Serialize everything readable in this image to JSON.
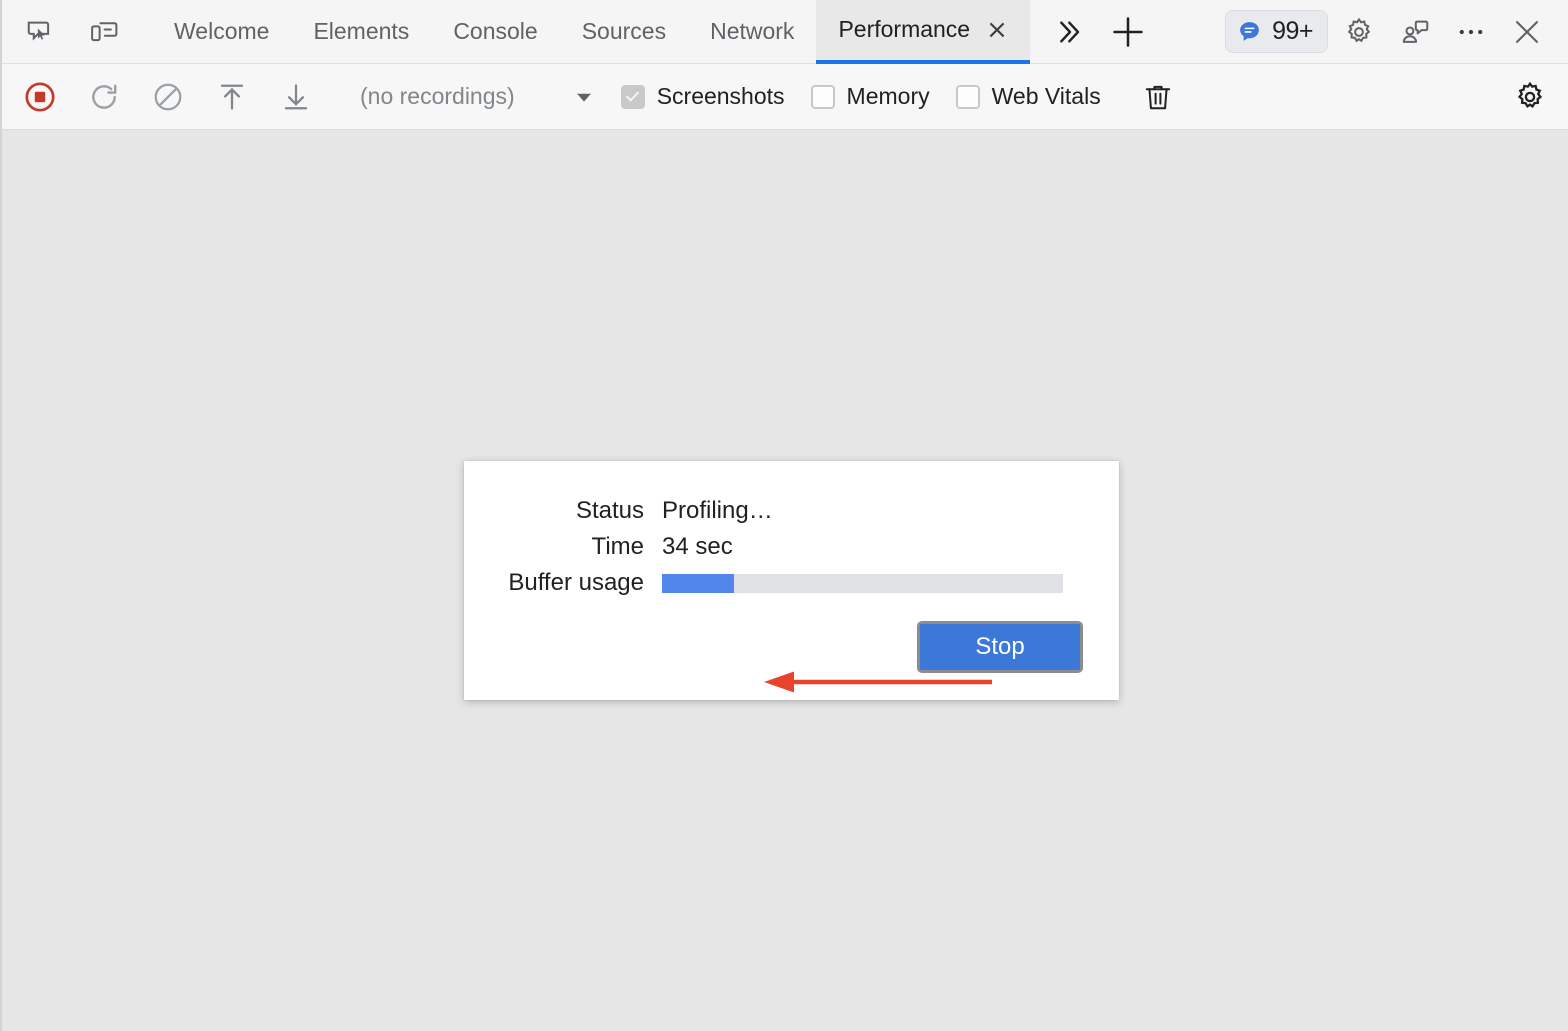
{
  "window": {
    "title": "Chrome DevTools – Performance panel"
  },
  "tabbar": {
    "left_icons": [
      {
        "name": "inspect-element-icon",
        "label": "Inspect element"
      },
      {
        "name": "device-toolbar-icon",
        "label": "Toggle device toolbar"
      }
    ],
    "tabs": [
      {
        "label": "Welcome",
        "selected": false
      },
      {
        "label": "Elements",
        "selected": false
      },
      {
        "label": "Console",
        "selected": false
      },
      {
        "label": "Sources",
        "selected": false
      },
      {
        "label": "Network",
        "selected": false
      },
      {
        "label": "Performance",
        "selected": true
      }
    ],
    "tab_close_glyph": "×",
    "more_tabs_glyph": "»",
    "add_tab_glyph": "+",
    "issues": {
      "count": "99+",
      "icon": "chat-bubble-icon",
      "accent": "#3b78d8"
    },
    "right_icons": [
      {
        "name": "settings-gear-icon",
        "label": "Settings"
      },
      {
        "name": "feedback-icon",
        "label": "Send feedback"
      },
      {
        "name": "more-options-icon",
        "label": "More options"
      },
      {
        "name": "close-devtools-icon",
        "label": "Close DevTools"
      }
    ]
  },
  "toolbar": {
    "record_button": {
      "name": "stop-recording-button",
      "label": "Stop recording",
      "state": "recording",
      "color": "#c5392b"
    },
    "reload_button": {
      "name": "record-and-reload-button",
      "label": "Record and reload"
    },
    "clear_button": {
      "name": "clear-button",
      "label": "Clear"
    },
    "load_button": {
      "name": "load-profile-button",
      "label": "Load profile"
    },
    "save_button": {
      "name": "save-profile-button",
      "label": "Save profile"
    },
    "recordings_select": {
      "value": "(no recordings)",
      "caret_glyph": "▼"
    },
    "checkboxes": [
      {
        "label": "Screenshots",
        "checked": true,
        "disabled": true
      },
      {
        "label": "Memory",
        "checked": false,
        "disabled": false
      },
      {
        "label": "Web Vitals",
        "checked": false,
        "disabled": false
      }
    ],
    "trash_button": {
      "name": "collect-garbage-button",
      "label": "Collect garbage"
    },
    "capture_settings_button": {
      "name": "capture-settings-gear-icon",
      "label": "Capture settings"
    }
  },
  "dialog": {
    "rows": [
      {
        "label": "Status",
        "value": "Profiling…"
      },
      {
        "label": "Time",
        "value": "34 sec"
      },
      {
        "label": "Buffer usage",
        "value": ""
      }
    ],
    "buffer_usage_percent": 18,
    "buffer_fill_color": "#5086ec",
    "buffer_track_color": "#e0e1e4",
    "stop_button_label": "Stop",
    "stop_button_color": "#3b78d8"
  },
  "annotation": {
    "arrow": {
      "name": "annotation-arrow",
      "points_to": "Time value",
      "color": "#e8432c",
      "direction": "left"
    }
  }
}
